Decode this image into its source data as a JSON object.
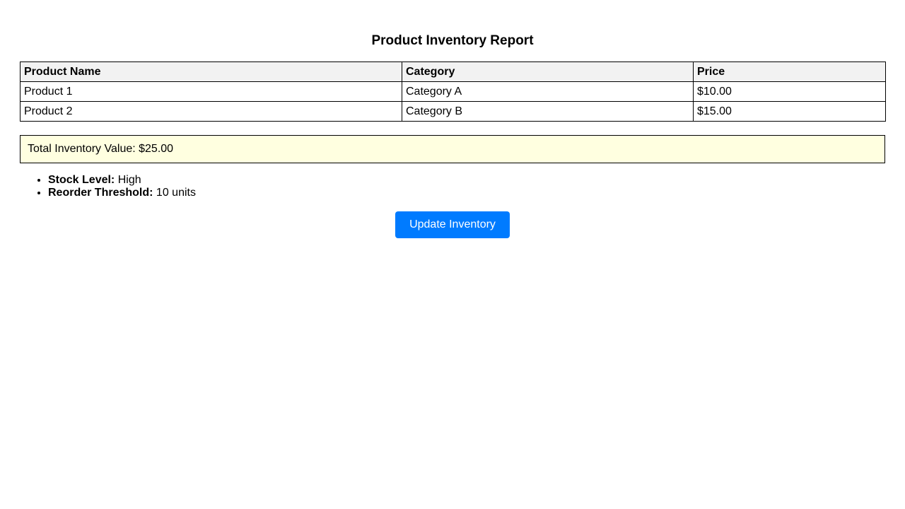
{
  "report": {
    "title": "Product Inventory Report"
  },
  "table": {
    "headers": [
      "Product Name",
      "Category",
      "Price"
    ],
    "rows": [
      [
        "Product 1",
        "Category A",
        "$10.00"
      ],
      [
        "Product 2",
        "Category B",
        "$15.00"
      ]
    ]
  },
  "summary": {
    "total_text": "Total Inventory Value: $25.00"
  },
  "details": [
    {
      "label": "Stock Level:",
      "value": "High"
    },
    {
      "label": "Reorder Threshold:",
      "value": "10 units"
    }
  ],
  "actions": {
    "update_label": "Update Inventory"
  },
  "colors": {
    "header_background": "#f2f2f2",
    "summary_background": "#ffffe0",
    "button_background": "#007bff",
    "button_text": "#ffffff",
    "border": "#000000"
  }
}
